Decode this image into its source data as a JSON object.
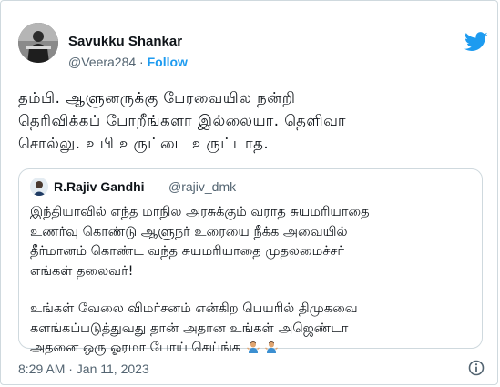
{
  "author": {
    "name": "Savukku Shankar",
    "handle": "@Veera284",
    "separator": "·",
    "follow_label": "Follow"
  },
  "tweet_lines": [
    "தம்பி.  ஆளுனருக்கு பேரவையில நன்றி",
    "தெரிவிக்கப் போறீங்களா இல்லையா.  தெளிவா",
    "சொல்லு.  உபி உருட்டை உருட்டாத."
  ],
  "quoted_tweet": {
    "name": "R.Rajiv Gandhi",
    "handle": "@rajiv_dmk",
    "paragraph1": [
      "இந்தியாவில் எந்த மாநில அரசுக்கும் வராத சுயமரியாதை",
      "உணர்வு கொண்டு ஆளுநர் உரையை நீக்க அவையில்",
      "தீர்மானம் கொண்ட வந்த சுயமரியாதை முதலமைச்சர்",
      "எங்கள் தலைவர்!"
    ],
    "paragraph2": [
      "உங்கள் வேலை விமர்சனம் என்கிற பெயரில் திமுகவை",
      "களங்கப்படுத்துவது தான் அதான உங்கள் அஜெண்டா",
      "அதனை ஒரு ஓரமா போய் செய்ங்க"
    ],
    "trailing_emoji": [
      "man-shrugging-emoji",
      "man-shrugging-emoji"
    ]
  },
  "timestamp": "8:29 AM · Jan 11, 2023",
  "icons": {
    "brand": "twitter-bird-icon",
    "info": "info-icon"
  },
  "colors": {
    "accent": "#1d9bf0",
    "secondary_text": "#536471",
    "border": "#cfd9de"
  }
}
